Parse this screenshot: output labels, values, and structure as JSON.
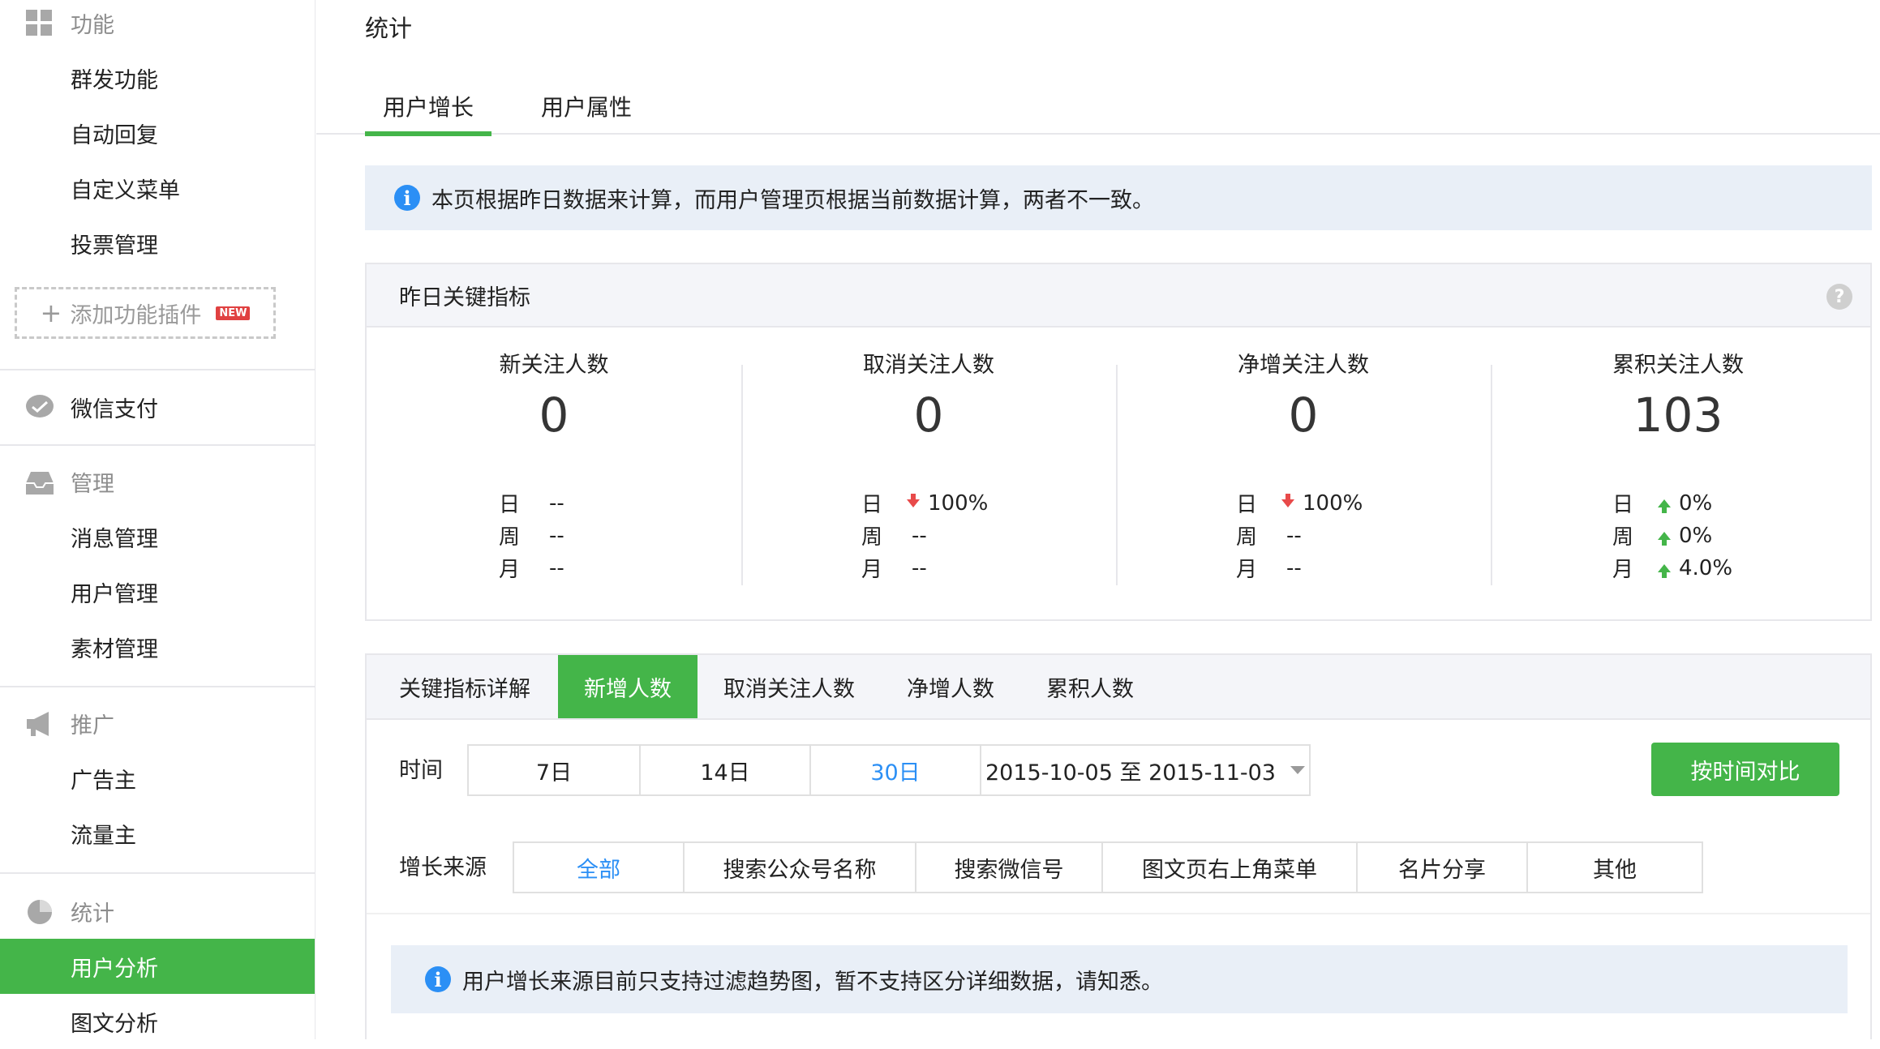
{
  "sidebar": {
    "group_function": "功能",
    "function_items": [
      "群发功能",
      "自动回复",
      "自定义菜单",
      "投票管理"
    ],
    "add_plugin": "添加功能插件",
    "new_badge": "NEW",
    "wechat_pay": "微信支付",
    "group_manage": "管理",
    "manage_items": [
      "消息管理",
      "用户管理",
      "素材管理"
    ],
    "group_promo": "推广",
    "promo_items": [
      "广告主",
      "流量主"
    ],
    "group_stats": "统计",
    "stats_items": [
      "用户分析",
      "图文分析"
    ],
    "active_item": "用户分析"
  },
  "main": {
    "page_title": "统计",
    "tabs": [
      "用户增长",
      "用户属性"
    ],
    "active_tab": "用户增长",
    "notice": "本页根据昨日数据来计算，而用户管理页根据当前数据计算，两者不一致。",
    "kpi_panel": {
      "title": "昨日关键指标",
      "help": "?",
      "period_labels": [
        "日",
        "周",
        "月"
      ],
      "items": [
        {
          "title": "新关注人数",
          "value": "0",
          "day": "--",
          "week": "--",
          "month": "--"
        },
        {
          "title": "取消关注人数",
          "value": "0",
          "day": "100%",
          "week": "--",
          "month": "--"
        },
        {
          "title": "净增关注人数",
          "value": "0",
          "day": "100%",
          "week": "--",
          "month": "--"
        },
        {
          "title": "累积关注人数",
          "value": "103",
          "day": "0%",
          "week": "0%",
          "month": "4.0%"
        }
      ]
    },
    "detail_panel": {
      "title": "关键指标详解",
      "sub_tabs": [
        "新增人数",
        "取消关注人数",
        "净增人数",
        "累积人数"
      ],
      "active_sub_tab": "新增人数",
      "time_label": "时间",
      "time_ranges": [
        "7日",
        "14日",
        "30日"
      ],
      "active_range": "30日",
      "date_range": "2015-10-05 至 2015-11-03",
      "compare_button": "按时间对比",
      "source_label": "增长来源",
      "sources": [
        "全部",
        "搜索公众号名称",
        "搜索微信号",
        "图文页右上角菜单",
        "名片分享",
        "其他"
      ],
      "active_source": "全部",
      "source_notice": "用户增长来源目前只支持过滤趋势图，暂不支持区分详细数据，请知悉。"
    }
  },
  "colors": {
    "accent": "#44b549",
    "info_blue": "#2b8ff5",
    "down_red": "#e84a4a"
  }
}
